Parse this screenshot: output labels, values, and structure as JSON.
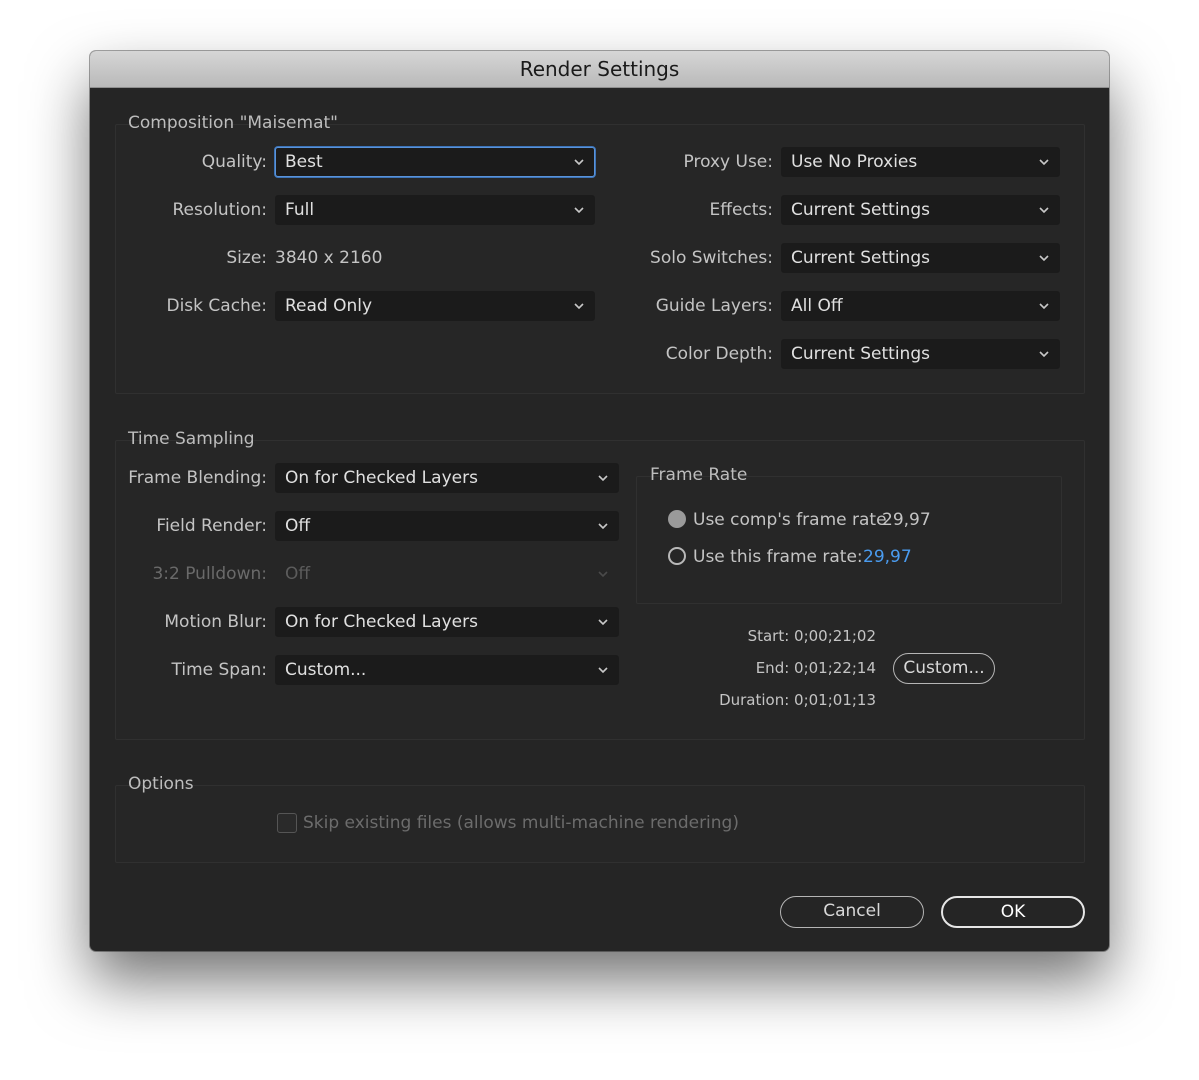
{
  "window": {
    "title": "Render Settings"
  },
  "composition": {
    "title": "Composition \"Maisemat\"",
    "quality_label": "Quality:",
    "quality_value": "Best",
    "resolution_label": "Resolution:",
    "resolution_value": "Full",
    "size_label": "Size:",
    "size_value": "3840 x 2160",
    "disk_cache_label": "Disk Cache:",
    "disk_cache_value": "Read Only",
    "proxy_use_label": "Proxy Use:",
    "proxy_use_value": "Use No Proxies",
    "effects_label": "Effects:",
    "effects_value": "Current Settings",
    "solo_switches_label": "Solo Switches:",
    "solo_switches_value": "Current Settings",
    "guide_layers_label": "Guide Layers:",
    "guide_layers_value": "All Off",
    "color_depth_label": "Color Depth:",
    "color_depth_value": "Current Settings"
  },
  "time_sampling": {
    "title": "Time Sampling",
    "frame_blending_label": "Frame Blending:",
    "frame_blending_value": "On for Checked Layers",
    "field_render_label": "Field Render:",
    "field_render_value": "Off",
    "pulldown_label": "3:2 Pulldown:",
    "pulldown_value": "Off",
    "motion_blur_label": "Motion Blur:",
    "motion_blur_value": "On for Checked Layers",
    "time_span_label": "Time Span:",
    "time_span_value": "Custom...",
    "frame_rate": {
      "title": "Frame Rate",
      "use_comp_label": "Use comp's frame rate",
      "use_comp_value": "29,97",
      "use_this_label": "Use this frame rate:",
      "use_this_value": "29,97"
    },
    "start": "Start: 0;00;21;02",
    "end": "End: 0;01;22;14",
    "duration": "Duration: 0;01;01;13",
    "custom_button": "Custom..."
  },
  "options": {
    "title": "Options",
    "skip_existing_label": "Skip existing files (allows multi-machine rendering)"
  },
  "buttons": {
    "cancel": "Cancel",
    "ok": "OK"
  },
  "colors": {
    "accent": "#4a9cf0",
    "window_bg": "#252525",
    "focus_ring": "#5a93d9"
  }
}
